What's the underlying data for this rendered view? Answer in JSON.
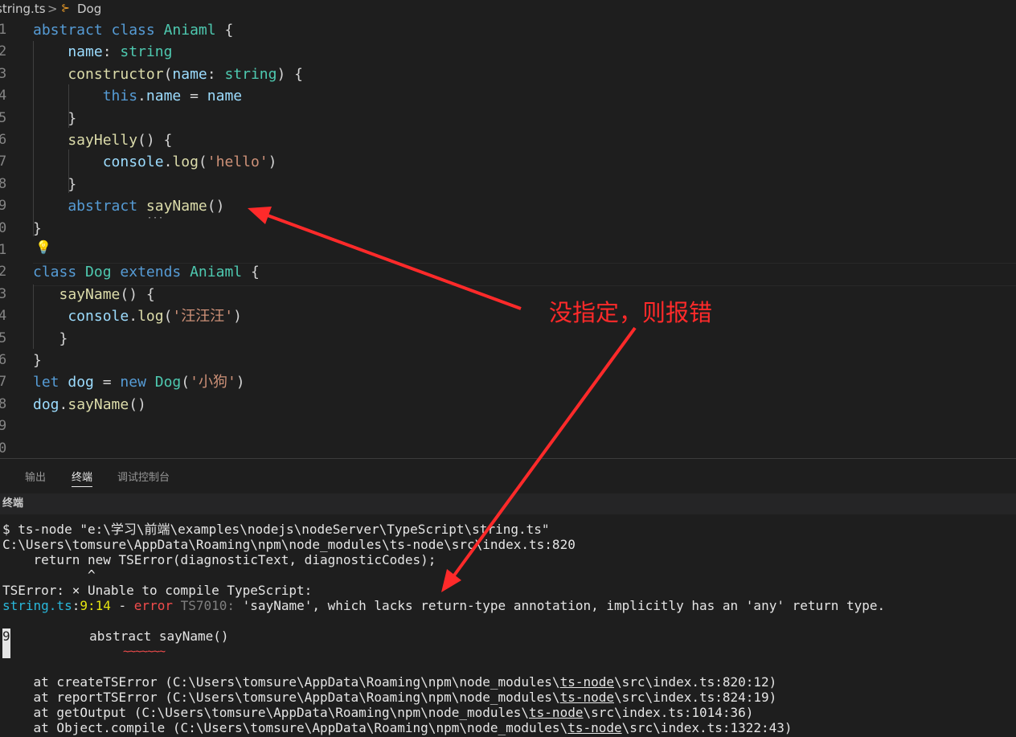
{
  "breadcrumb": {
    "file": "string.ts",
    "separator": ">",
    "symbol_icon": "class-symbol-icon",
    "symbol": "Dog"
  },
  "editor": {
    "line_numbers": [
      "1",
      "2",
      "3",
      "4",
      "5",
      "6",
      "7",
      "8",
      "9",
      "0",
      "1",
      "2",
      "3",
      "4",
      "5",
      "6",
      "7",
      "8",
      "9",
      "0"
    ],
    "lines": [
      [
        [
          "kw",
          "abstract "
        ],
        [
          "kw",
          "class "
        ],
        [
          "cls",
          "Aniaml "
        ],
        [
          "pun",
          "{"
        ]
      ],
      [
        [
          "prop",
          "    name"
        ],
        [
          "pun",
          ": "
        ],
        [
          "ty",
          "string"
        ]
      ],
      [
        [
          "fn",
          "    constructor"
        ],
        [
          "pun",
          "("
        ],
        [
          "prop",
          "name"
        ],
        [
          "pun",
          ": "
        ],
        [
          "ty",
          "string"
        ],
        [
          "pun",
          ") {"
        ]
      ],
      [
        [
          "kw",
          "        this"
        ],
        [
          "pun",
          "."
        ],
        [
          "prop",
          "name"
        ],
        [
          "pun",
          " = "
        ],
        [
          "prop",
          "name"
        ]
      ],
      [
        [
          "pun",
          "    }"
        ]
      ],
      [
        [
          "fn",
          "    sayHelly"
        ],
        [
          "pun",
          "() {"
        ]
      ],
      [
        [
          "prop",
          "        console"
        ],
        [
          "pun",
          "."
        ],
        [
          "fn",
          "log"
        ],
        [
          "pun",
          "("
        ],
        [
          "str",
          "'hello'"
        ],
        [
          "pun",
          ")"
        ]
      ],
      [
        [
          "pun",
          "    }"
        ]
      ],
      [
        [
          "kw",
          "    abstract "
        ],
        [
          "fn",
          "sayName"
        ],
        [
          "pun",
          "()"
        ]
      ],
      [
        [
          "pun",
          "}"
        ]
      ],
      [],
      [
        [
          "kw",
          "class "
        ],
        [
          "cls",
          "Dog "
        ],
        [
          "kw",
          "extends "
        ],
        [
          "cls",
          "Aniaml "
        ],
        [
          "pun",
          "{"
        ]
      ],
      [
        [
          "fn",
          "   sayName"
        ],
        [
          "pun",
          "() {"
        ]
      ],
      [
        [
          "prop",
          "    console"
        ],
        [
          "pun",
          "."
        ],
        [
          "fn",
          "log"
        ],
        [
          "pun",
          "("
        ],
        [
          "str",
          "'汪汪汪'"
        ],
        [
          "pun",
          ")"
        ]
      ],
      [
        [
          "pun",
          "   }"
        ]
      ],
      [
        [
          "pun",
          "}"
        ]
      ],
      [
        [
          "kw",
          "let "
        ],
        [
          "prop",
          "dog"
        ],
        [
          "pun",
          " = "
        ],
        [
          "kw",
          "new "
        ],
        [
          "cls",
          "Dog"
        ],
        [
          "pun",
          "("
        ],
        [
          "str",
          "'小狗'"
        ],
        [
          "pun",
          ")"
        ]
      ],
      [
        [
          "prop",
          "dog"
        ],
        [
          "pun",
          "."
        ],
        [
          "fn",
          "sayName"
        ],
        [
          "pun",
          "()"
        ]
      ],
      [],
      []
    ],
    "lightbulb_icon": "lightbulb-icon"
  },
  "panel": {
    "tabs": [
      "输出",
      "终端",
      "调试控制台"
    ],
    "active_tab": "终端",
    "terminal_title": "终端"
  },
  "terminal": {
    "cmd": "$ ts-node \"e:\\学习\\前端\\examples\\nodejs\\nodeServer\\TypeScript\\string.ts\"",
    "path": "C:\\Users\\tomsure\\AppData\\Roaming\\npm\\node_modules\\ts-node\\src\\index.ts:820",
    "ret": "    return new TSError(diagnosticText, diagnosticCodes);",
    "caret": "           ^",
    "tserror": "TSError: × Unable to compile TypeScript:",
    "err_file": "string.ts",
    "err_sep": ":",
    "err_line": "9",
    "err_col": ":14",
    "err_dash": " - ",
    "err_word": "error",
    "err_code": " TS7010:",
    "err_msg": " 'sayName', which lacks return-type annotation, implicitly has an 'any' return type.",
    "src_lineno": "9",
    "src_line": "     abstract sayName()",
    "squiggle": "~~~~~~~",
    "stack": [
      {
        "pre": "    at createTSError (C:\\Users\\tomsure\\AppData\\Roaming\\npm\\node_modules\\",
        "u": "ts-node",
        "post": "\\src\\index.ts:820:12)"
      },
      {
        "pre": "    at reportTSError (C:\\Users\\tomsure\\AppData\\Roaming\\npm\\node_modules\\",
        "u": "ts-node",
        "post": "\\src\\index.ts:824:19)"
      },
      {
        "pre": "    at getOutput (C:\\Users\\tomsure\\AppData\\Roaming\\npm\\node_modules\\",
        "u": "ts-node",
        "post": "\\src\\index.ts:1014:36)"
      },
      {
        "pre": "    at Object.compile (C:\\Users\\tomsure\\AppData\\Roaming\\npm\\node_modules\\",
        "u": "ts-node",
        "post": "\\src\\index.ts:1322:43)"
      }
    ]
  },
  "annotation": {
    "text": "没指定，则报错",
    "color": "#ff2a2a"
  }
}
